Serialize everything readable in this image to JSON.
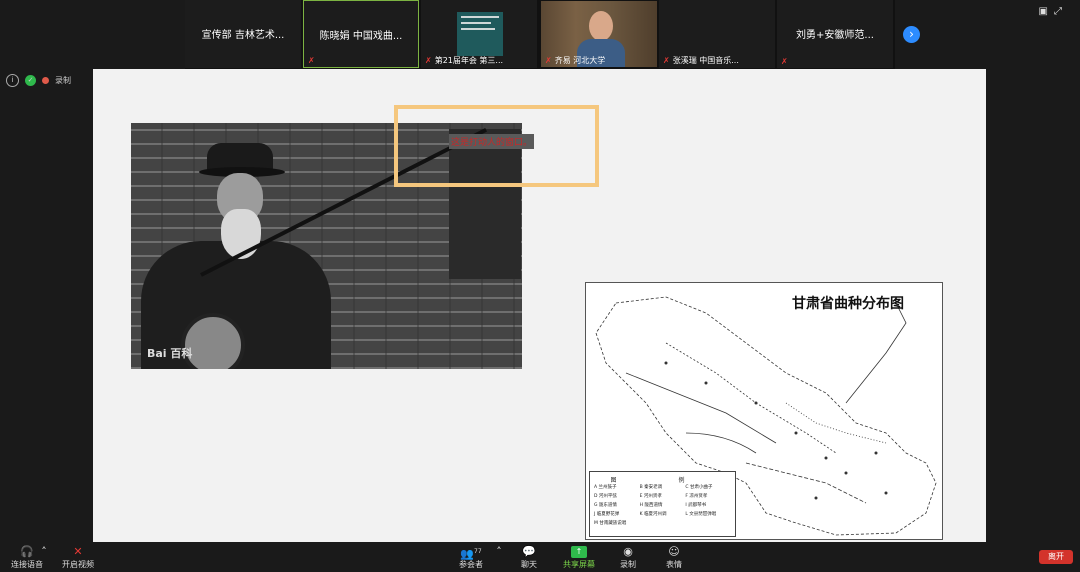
{
  "participants": [
    {
      "name": "宣传部 吉林艺术..."
    },
    {
      "name": "陈晓娟 中国戏曲..."
    },
    {
      "caption": "第21届年会 第三..."
    },
    {
      "caption": "齐易 河北大学"
    },
    {
      "caption": "张溪瑞 中国音乐..."
    },
    {
      "name": "刘勇+安徽师范..."
    }
  ],
  "self_status": {
    "label": "录制"
  },
  "slide": {
    "photo_watermark": "Bai 百科",
    "highlight_text": "这是打动人的窗口。",
    "map": {
      "title": "甘肃省曲种分布图",
      "legend_title": "图 例",
      "legend_items": [
        "A 兰州鼓子",
        "B 秦安老调",
        "C 甘肃小曲子",
        "D 河州平弦",
        "E 河州贤孝",
        "F 凉州贤孝",
        "G 陇东道情",
        "H 陇西道情",
        "I 武都琴书",
        "J 临夏野花弹",
        "K 临夏河州调",
        "L 文县琵琶弹唱",
        "M 甘南藏族说唱"
      ]
    }
  },
  "toolbar": {
    "audio": "连接语音",
    "video": "开启视频",
    "participants": "参会者",
    "participant_count": "77",
    "chat": "聊天",
    "share": "共享屏幕",
    "record": "录制",
    "reactions": "表情",
    "leave": "离开"
  },
  "colors": {
    "share_green": "#2fb94c",
    "leave_red": "#d3332b",
    "highlight": "#f5c77e",
    "active_border": "#7cb342",
    "next_blue": "#2d8cff"
  }
}
